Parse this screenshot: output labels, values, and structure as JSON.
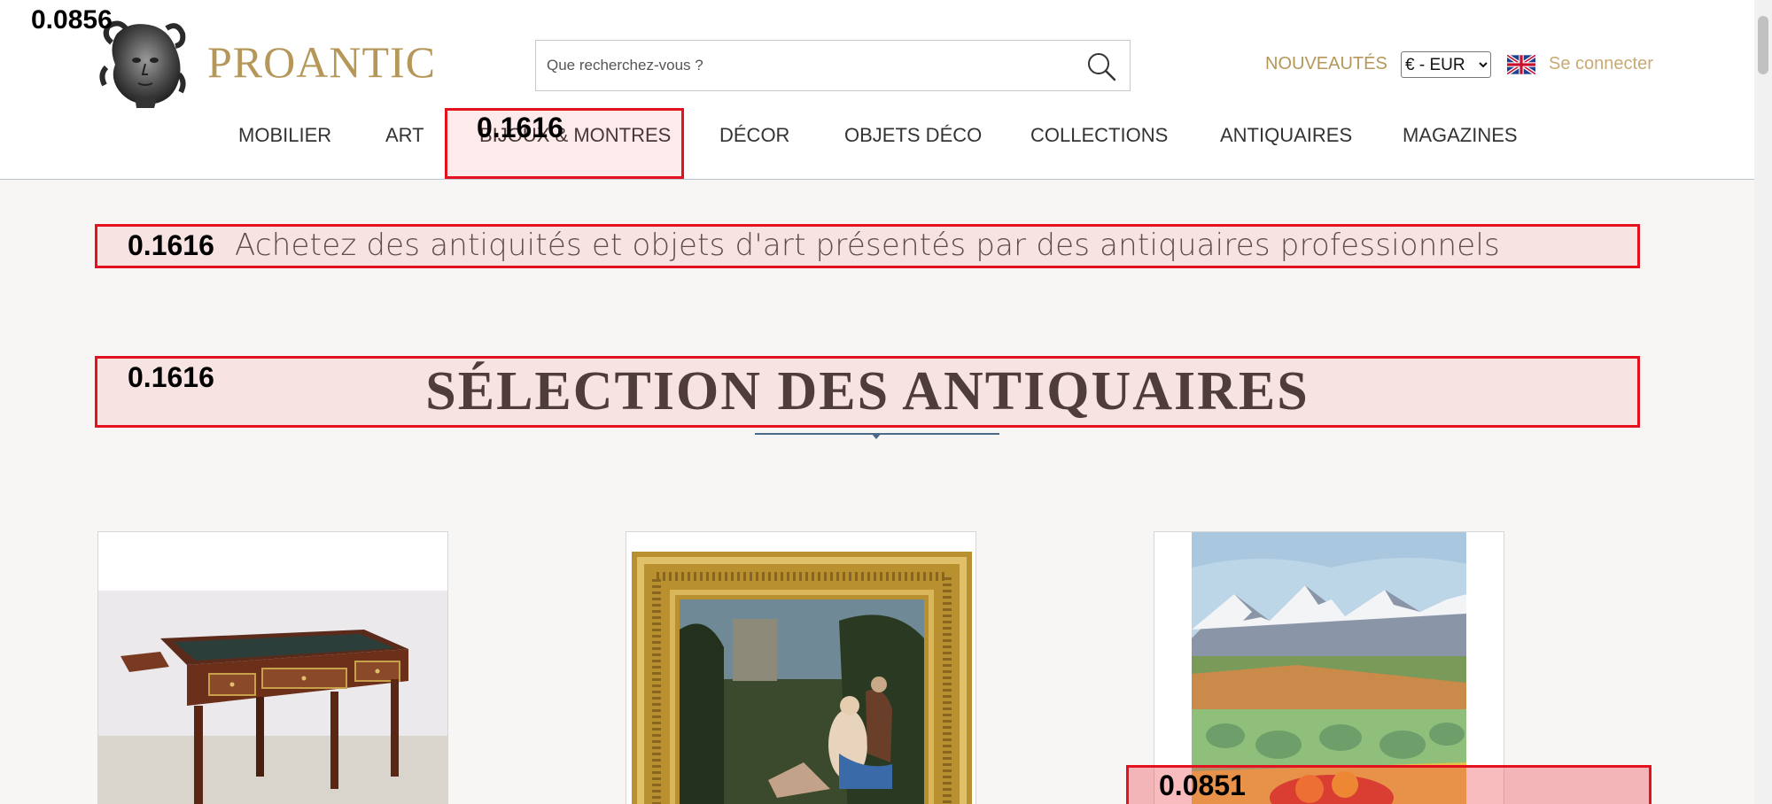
{
  "brand": {
    "name": "PROANTIC",
    "color": "#b5975a"
  },
  "search": {
    "placeholder": "Que recherchez-vous ?",
    "icon": "search-icon"
  },
  "header_links": {
    "nouveautes": "NOUVEAUTÉS",
    "currency_options": [
      "€ - EUR"
    ],
    "currency_selected": "€ - EUR",
    "flag_icon": "uk-flag-icon",
    "login": "Se connecter",
    "link_color": "#b5975a",
    "login_color": "#c8aa74"
  },
  "nav": {
    "items": [
      "MOBILIER",
      "ART",
      "BIJOUX & MONTRES",
      "DÉCOR",
      "OBJETS DÉCO",
      "COLLECTIONS",
      "ANTIQUAIRES",
      "MAGAZINES"
    ]
  },
  "main": {
    "tagline": "Achetez des antiquités et objets d'art présentés par des antiquaires professionnels",
    "section_title": "SÉLECTION DES ANTIQUAIRES",
    "accent_color": "#4b6a89"
  },
  "products": [
    {
      "image": "mahogany-desk-image"
    },
    {
      "image": "gilt-framed-painting-image"
    },
    {
      "image": "provence-landscape-painting-image"
    }
  ],
  "overlays": {
    "scores": [
      "0.0856",
      "0.1616",
      "0.1616",
      "0.1616",
      "0.0851"
    ],
    "highlight_color": "#e3121e"
  }
}
